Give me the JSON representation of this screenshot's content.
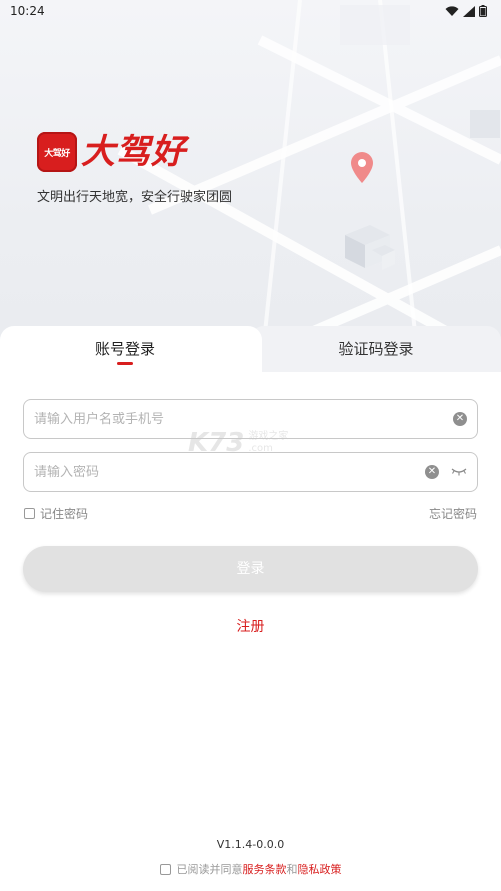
{
  "status_bar": {
    "time": "10:24"
  },
  "brand": {
    "logo_text": "大驾好",
    "name": "大驾好",
    "slogan": "文明出行天地宽，安全行驶家团圆"
  },
  "tabs": [
    {
      "label": "账号登录",
      "active": true
    },
    {
      "label": "验证码登录",
      "active": false
    }
  ],
  "form": {
    "username_placeholder": "请输入用户名或手机号",
    "password_placeholder": "请输入密码",
    "remember_label": "记住密码",
    "forgot_label": "忘记密码",
    "login_label": "登录",
    "register_label": "注册"
  },
  "footer": {
    "version": "V1.1.4-0.0.0",
    "agree_prefix": "已阅读并同意",
    "terms": "服务条款",
    "and": "和",
    "privacy": "隐私政策"
  },
  "watermark": {
    "logo": "K73",
    "line1": "游戏之家",
    "line2": ".com"
  },
  "colors": {
    "accent": "#d81e1e",
    "button_disabled": "#e1e1e1"
  }
}
